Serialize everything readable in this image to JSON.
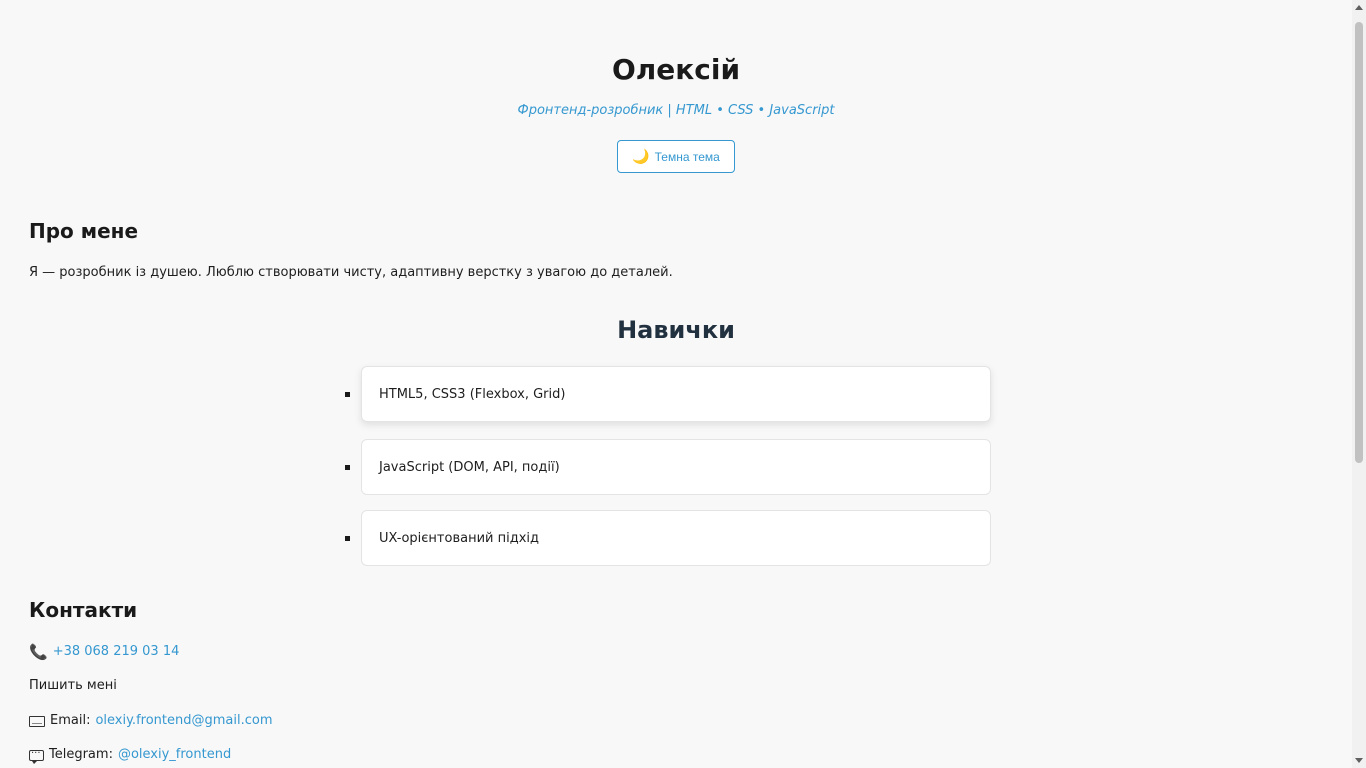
{
  "header": {
    "name": "Олексій",
    "subtitle": "Фронтенд-розробник | HTML • CSS • JavaScript",
    "theme_button": {
      "icon": "moon-icon",
      "icon_glyph": "🌙",
      "label": "Темна тема"
    }
  },
  "about": {
    "title": "Про мене",
    "text": "Я — розробник із душею. Люблю створювати чисту, адаптивну верстку з увагою до деталей."
  },
  "skills": {
    "title": "Навички",
    "items": [
      {
        "label": "HTML5, CSS3 (Flexbox, Grid)"
      },
      {
        "label": "JavaScript (DOM, API, події)"
      },
      {
        "label": "UX-орієнтований підхід"
      }
    ]
  },
  "contacts": {
    "title": "Контакти",
    "phone": {
      "icon": "phone-icon",
      "icon_glyph": "📞",
      "value": "+38 068 219 03 14"
    },
    "write_me": "Пишить мені",
    "email": {
      "icon": "mail-icon",
      "label": "Email:",
      "value": "olexiy.frontend@gmail.com"
    },
    "telegram": {
      "icon": "chat-icon",
      "label": "Telegram:",
      "value": "@olexiy_frontend"
    }
  },
  "colors": {
    "accent": "#3598d0",
    "background": "#f8f8f8",
    "heading": "#1a1a1a",
    "skills_heading": "#22313f"
  }
}
